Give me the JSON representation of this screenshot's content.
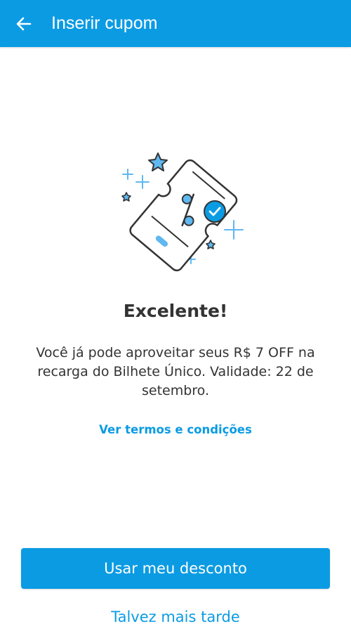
{
  "header": {
    "title": "Inserir cupom",
    "back_icon": "arrow-left-icon"
  },
  "illustration": {
    "icon": "coupon-ticket-check-icon",
    "accent_color": "#0b9be3",
    "light_color": "#5fb8f0"
  },
  "content": {
    "heading": "Excelente!",
    "message": "Você já pode aproveitar seus R$ 7 OFF na recarga do Bilhete Único. Validade: 22 de setembro.",
    "terms_link": "Ver termos e condições"
  },
  "actions": {
    "primary_label": "Usar meu desconto",
    "secondary_label": "Talvez mais tarde"
  },
  "colors": {
    "brand": "#0b9be3",
    "text": "#333333",
    "background": "#ffffff"
  }
}
